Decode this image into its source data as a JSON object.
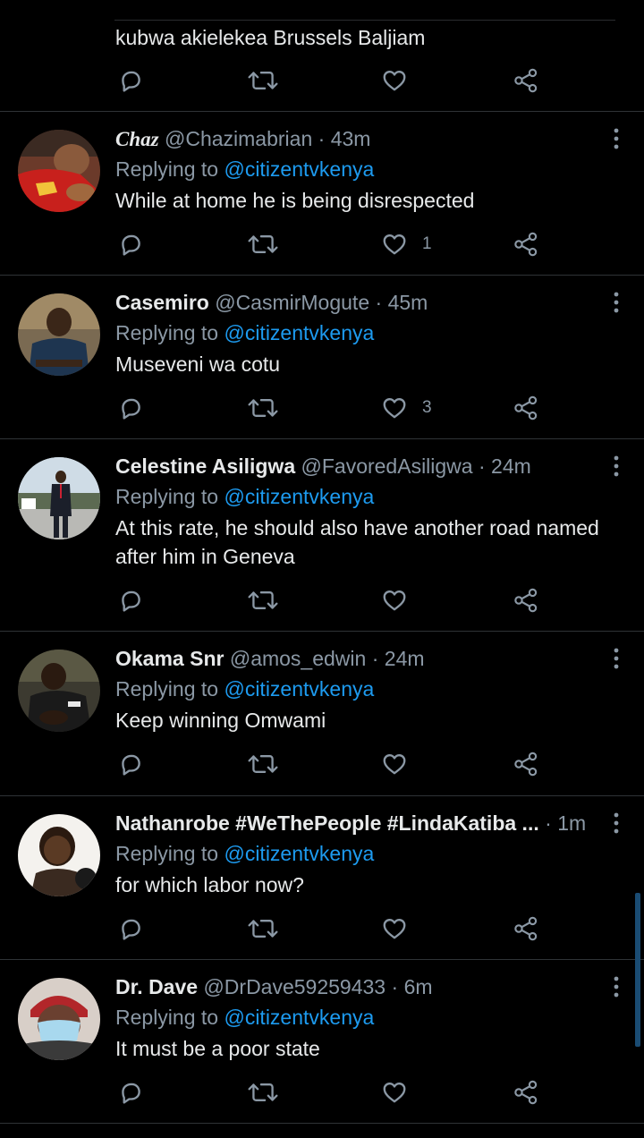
{
  "partial_tweet": {
    "text": "kubwa akielekea Brussels Baljiam"
  },
  "icons": {
    "reply": "reply-icon",
    "retweet": "retweet-icon",
    "like": "heart-icon",
    "share": "share-icon",
    "more": "more-vertical-icon"
  },
  "colors": {
    "background": "#000000",
    "link": "#1d9bf0",
    "muted": "#8b98a5",
    "divider": "#2f3336"
  },
  "replying_to_label": "Replying to",
  "mention": "@citizentvkenya",
  "tweets": [
    {
      "name": "Chaz",
      "handle": "@Chazimabrian",
      "separator": "·",
      "time": "43m",
      "text": "While at home he is being disrespected",
      "likes": "1"
    },
    {
      "name": "Casemiro",
      "handle": "@CasmirMogute",
      "separator": "·",
      "time": "45m",
      "text": "Museveni wa cotu",
      "likes": "3"
    },
    {
      "name": "Celestine Asiligwa",
      "handle": "@FavoredAsiligwa",
      "separator": "·",
      "time": "24m",
      "text": "At this rate, he should also have another road named after him in Geneva",
      "likes": ""
    },
    {
      "name": "Okama Snr",
      "handle": "@amos_edwin",
      "separator": "·",
      "time": "24m",
      "text": "Keep winning Omwami",
      "likes": ""
    },
    {
      "name": "Nathanrobe #WeThePeople #LindaKatiba ...",
      "handle": "",
      "separator": "·",
      "time": "1m",
      "text": "for which labor now?",
      "likes": ""
    },
    {
      "name": "Dr. Dave",
      "handle": "@DrDave59259433",
      "separator": "·",
      "time": "6m",
      "text": "It must be a poor state",
      "likes": ""
    }
  ]
}
